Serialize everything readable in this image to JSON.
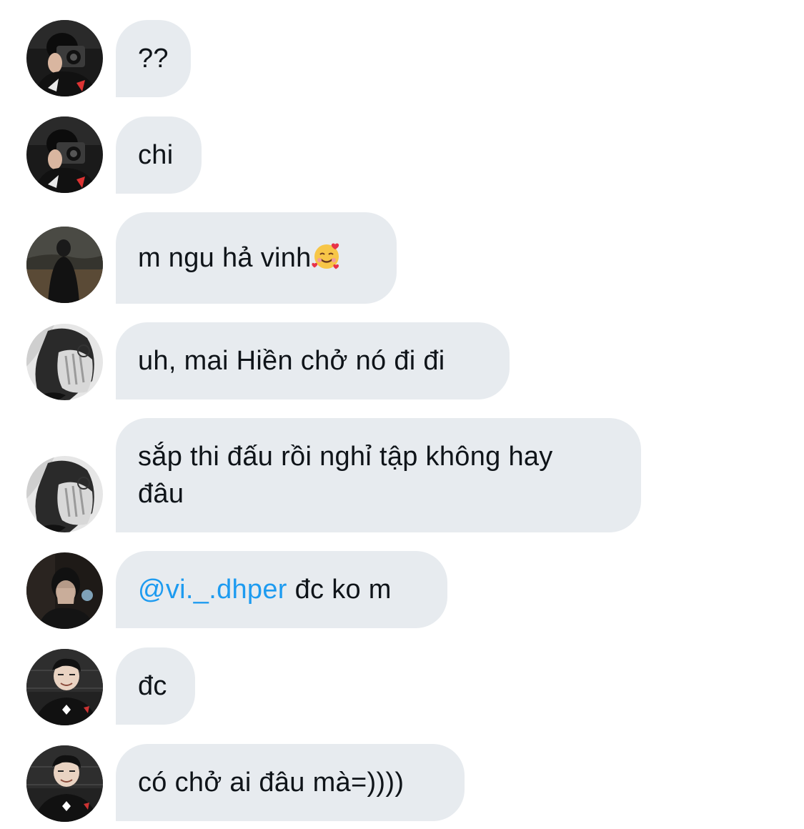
{
  "messages": [
    {
      "avatar": "avatar-camera-user",
      "text": "??"
    },
    {
      "avatar": "avatar-camera-user",
      "text": "chi"
    },
    {
      "avatar": "avatar-dark-outdoor-user",
      "text": "m ngu hả vinh",
      "emoji": "smiling-face-with-hearts-icon"
    },
    {
      "avatar": "avatar-glasses-hand-user",
      "text": "uh, mai Hiền chở nó đi đi"
    },
    {
      "avatar": "avatar-glasses-hand-user",
      "line1": "sắp thi đấu rồi nghỉ tập không hay",
      "line2": "đâu"
    },
    {
      "avatar": "avatar-covering-face-user",
      "mention": "@vi._.dhper",
      "text": " đc ko m"
    },
    {
      "avatar": "avatar-esports-user",
      "text": "đc"
    },
    {
      "avatar": "avatar-esports-user",
      "text": "có chở ai đâu mà=))))"
    }
  ],
  "colors": {
    "bubble": "#e7ebef",
    "text": "#0f1419",
    "mention": "#1d9bf0",
    "background": "#ffffff"
  }
}
